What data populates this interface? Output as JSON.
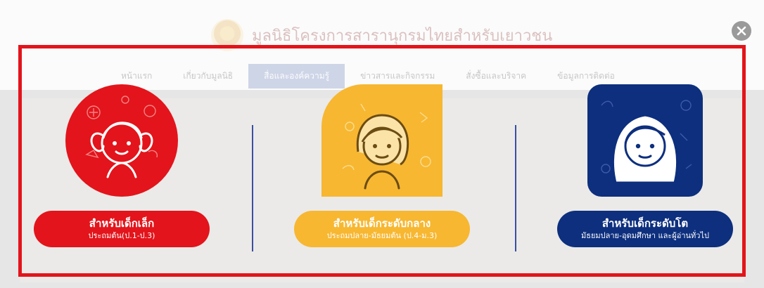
{
  "background": {
    "site_title": "มูลนิธิโครงการสารานุกรมไทยสำหรับเยาวชน",
    "nav_items": [
      "หน้าแรก",
      "เกี่ยวกับมูลนิธิ",
      "สื่อและองค์ความรู้",
      "ข่าวสารและกิจกรรม",
      "สั่งซื้อและบริจาค",
      "ข้อมูลการติดต่อ"
    ]
  },
  "modal": {
    "close_icon": "close-icon",
    "cards": [
      {
        "title": "สำหรับเด็กเล็ก",
        "subtitle": "ประถมต้น(ป.1-ป.3)",
        "color": "#e3141b",
        "icon": "child-girl-pigtails-icon"
      },
      {
        "title": "สำหรับเด็กระดับกลาง",
        "subtitle": "ประถมปลาย-มัธยมต้น (ป.4-ม.3)",
        "color": "#f7b731",
        "icon": "child-girl-bob-icon"
      },
      {
        "title": "สำหรับเด็กระดับโต",
        "subtitle": "มัธยมปลาย-อุดมศึกษา และผู้อ่านทั่วไป",
        "color": "#0d2f7e",
        "icon": "teen-girl-long-hair-icon"
      }
    ]
  }
}
